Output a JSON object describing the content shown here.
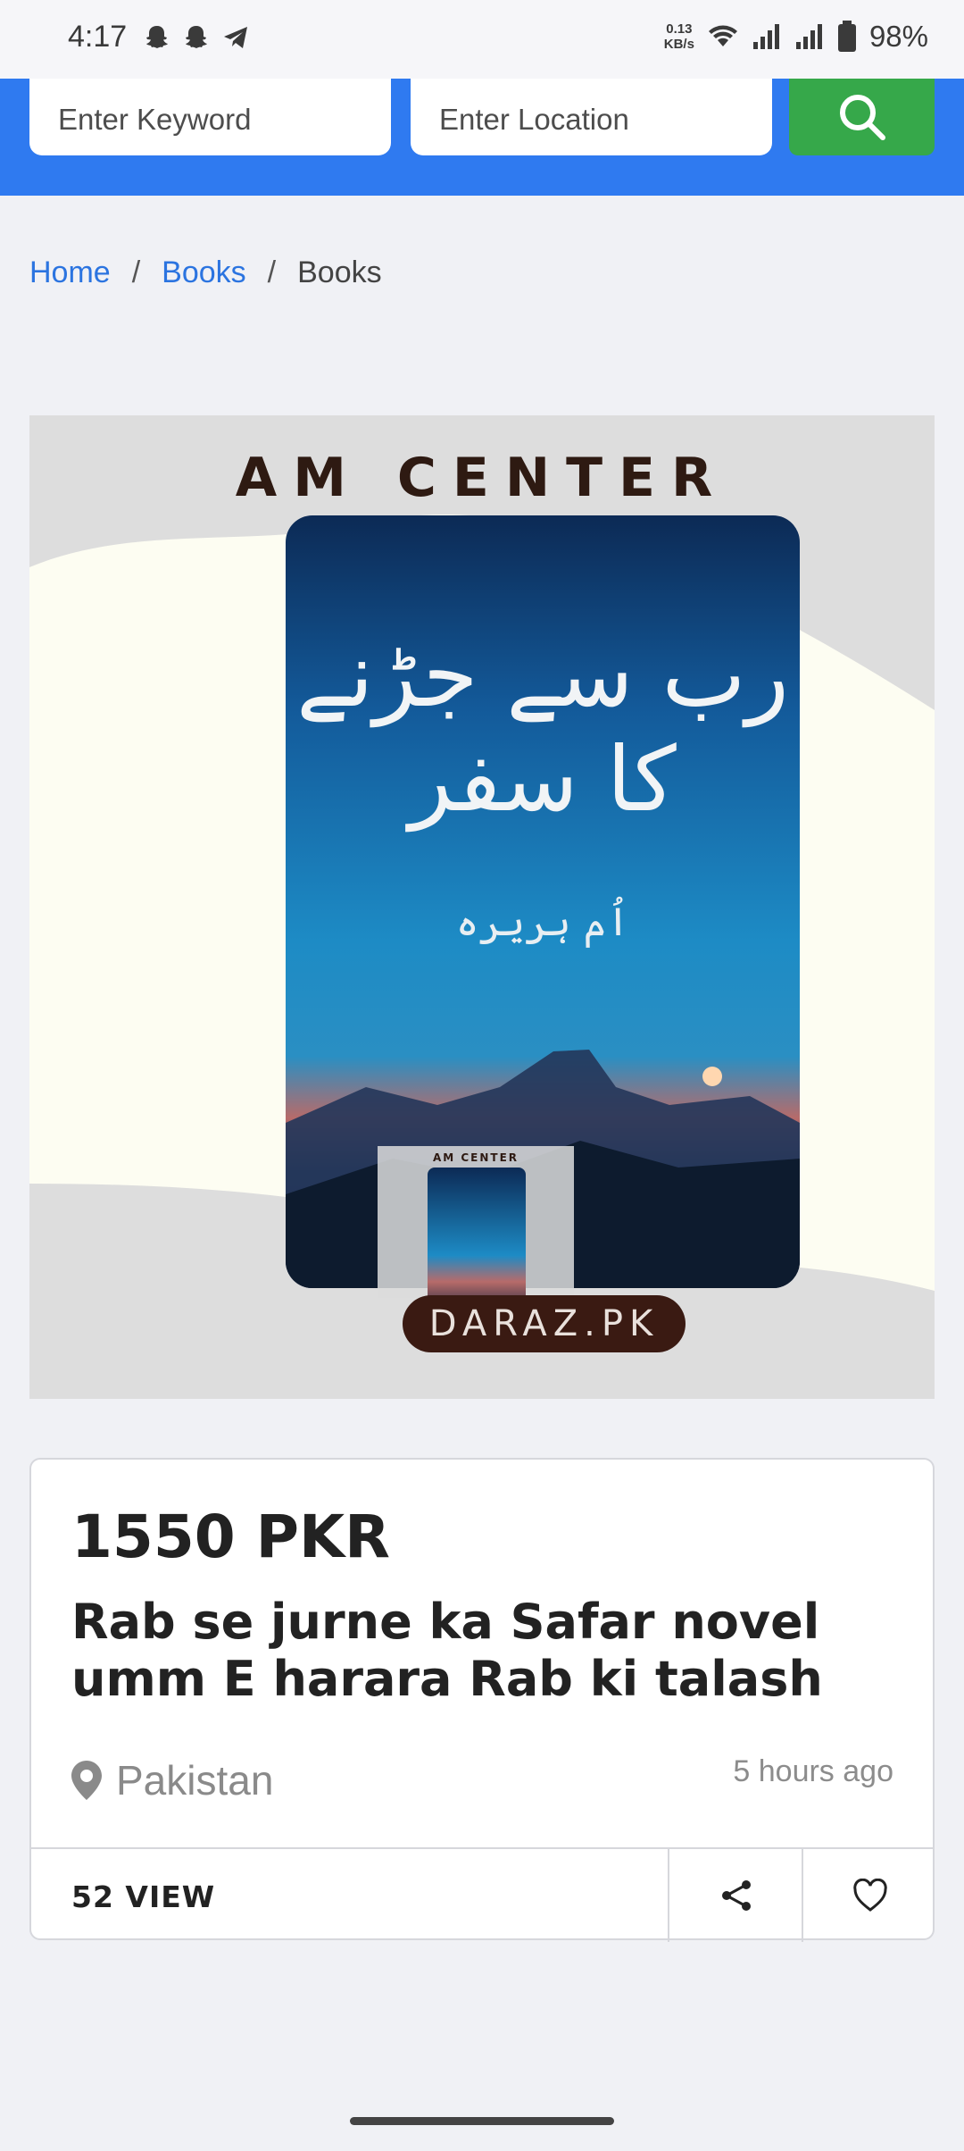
{
  "status_bar": {
    "time": "4:17",
    "net_speed_value": "0.13",
    "net_speed_unit": "KB/s",
    "battery": "98%"
  },
  "search": {
    "keyword_placeholder": "Enter Keyword",
    "location_placeholder": "Enter Location",
    "search_icon": "search-icon"
  },
  "breadcrumb": {
    "items": [
      "Home",
      "Books",
      "Books"
    ],
    "separator": "/"
  },
  "product_image": {
    "brand_top": "AM CENTER",
    "cover_title": "رب سے جڑنے کا سفر",
    "cover_author": "اُم ہریرہ",
    "brand_bottom": "DARAZ.PK"
  },
  "listing": {
    "price": "1550 PKR",
    "title": "Rab se jurne ka Safar novel umm E harara Rab ki talash",
    "location": "Pakistan",
    "time_ago": "5 hours ago",
    "views": "52 VIEW"
  },
  "colors": {
    "header_blue": "#2f7af0",
    "search_green": "#36a84a",
    "link_blue": "#2b74e0"
  }
}
